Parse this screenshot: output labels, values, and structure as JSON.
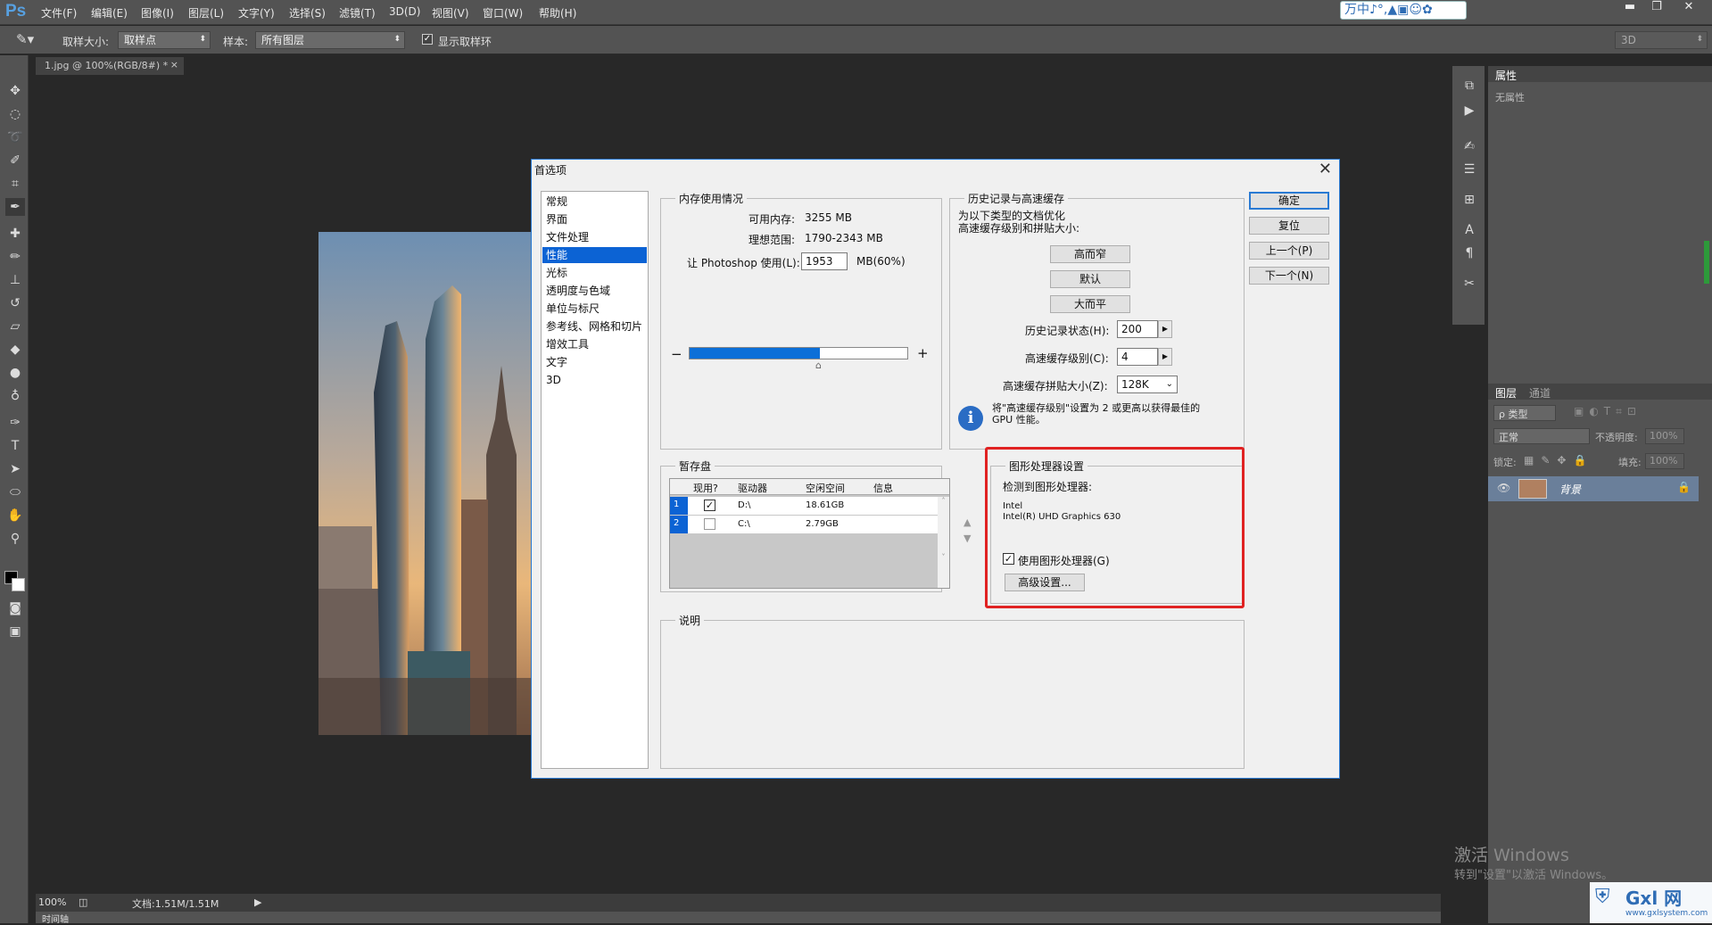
{
  "menubar": {
    "logo": "Ps",
    "items": [
      "文件(F)",
      "编辑(E)",
      "图像(I)",
      "图层(L)",
      "文字(Y)",
      "选择(S)",
      "滤镜(T)",
      "3D(D)",
      "视图(V)",
      "窗口(W)",
      "帮助(H)"
    ],
    "ime_text": "万中♪°,▲▣☺✿"
  },
  "options": {
    "sample_size_label": "取样大小:",
    "sample_size_value": "取样点",
    "sample_label": "样本:",
    "sample_value": "所有图层",
    "show_ring_label": "显示取样环",
    "workspace": "3D"
  },
  "document": {
    "tab_label": "1.jpg @ 100%(RGB/8#) *",
    "close": "×",
    "zoom": "100%",
    "doc_size": "文档:1.51M/1.51M",
    "timeline_label": "时间轴"
  },
  "right_panel": {
    "properties_tab": "属性",
    "properties_empty": "无属性",
    "layers_tab": "图层",
    "channels_tab": "通道",
    "filter_kind": "ρ 类型",
    "blend_mode": "正常",
    "opacity_label": "不透明度:",
    "opacity_value": "100%",
    "lock_label": "锁定:",
    "fill_label": "填充:",
    "fill_value": "100%",
    "layer_name": "背景"
  },
  "watermark": {
    "activate_title": "激活 Windows",
    "activate_sub": "转到\"设置\"以激活 Windows。",
    "site_logo": "Gxl 网",
    "site_url": "www.gxlsystem.com"
  },
  "dialog": {
    "title": "首选项",
    "categories": [
      "常规",
      "界面",
      "文件处理",
      "性能",
      "光标",
      "透明度与色域",
      "单位与标尺",
      "参考线、网格和切片",
      "增效工具",
      "文字",
      "3D"
    ],
    "selected_category": "性能",
    "buttons": {
      "ok": "确定",
      "reset": "复位",
      "prev": "上一个(P)",
      "next": "下一个(N)"
    },
    "memory": {
      "legend": "内存使用情况",
      "available_label": "可用内存:",
      "available_value": "3255 MB",
      "ideal_label": "理想范围:",
      "ideal_value": "1790-2343 MB",
      "let_label": "让 Photoshop 使用(L):",
      "let_value": "1953",
      "let_unit": "MB(60%)",
      "usage_fraction": 0.6,
      "minus": "−",
      "plus": "+"
    },
    "history": {
      "legend": "历史记录与高速缓存",
      "desc": "为以下类型的文档优化\n高速缓存级别和拼贴大小:",
      "btn_tall": "高而窄",
      "btn_default": "默认",
      "btn_big": "大而平",
      "states_label": "历史记录状态(H):",
      "states_value": "200",
      "levels_label": "高速缓存级别(C):",
      "levels_value": "4",
      "tile_label": "高速缓存拼贴大小(Z):",
      "tile_value": "128K",
      "info": "将\"高速缓存级别\"设置为 2 或更高以获得最佳的\nGPU 性能。"
    },
    "scratch": {
      "legend": "暂存盘",
      "headers": [
        "现用?",
        "驱动器",
        "空闲空间",
        "信息"
      ],
      "rows": [
        {
          "num": "1",
          "active": true,
          "drive": "D:\\",
          "free": "18.61GB",
          "info": ""
        },
        {
          "num": "2",
          "active": false,
          "drive": "C:\\",
          "free": "2.79GB",
          "info": ""
        }
      ]
    },
    "gpu": {
      "legend": "图形处理器设置",
      "detected_label": "检测到图形处理器:",
      "vendor": "Intel",
      "model": "Intel(R) UHD Graphics 630",
      "use_label": "使用图形处理器(G)",
      "use_checked": true,
      "advanced": "高级设置..."
    },
    "description": {
      "legend": "说明"
    }
  }
}
